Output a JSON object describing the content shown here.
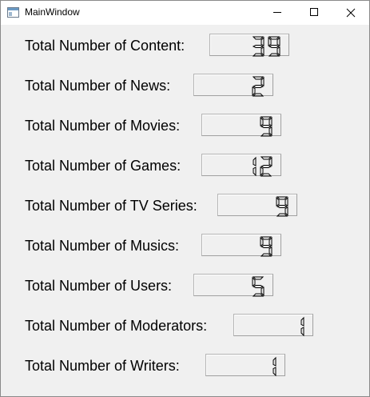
{
  "window": {
    "title": "MainWindow",
    "controls": {
      "minimize": "minimize-icon",
      "maximize": "maximize-icon",
      "close": "close-icon"
    }
  },
  "stats": [
    {
      "label": "Total Number of Content:",
      "value": "39"
    },
    {
      "label": "Total Number of News:",
      "value": "2"
    },
    {
      "label": "Total Number of Movies:",
      "value": "9"
    },
    {
      "label": "Total Number of Games:",
      "value": "12"
    },
    {
      "label": "Total Number of TV Series:",
      "value": "9"
    },
    {
      "label": "Total Number of Musics:",
      "value": "9"
    },
    {
      "label": "Total Number of Users:",
      "value": "5"
    },
    {
      "label": "Total Number of Moderators:",
      "value": "1"
    },
    {
      "label": "Total Number of Writers:",
      "value": "1"
    }
  ],
  "colors": {
    "window_bg": "#f0f0f0",
    "titlebar_bg": "#ffffff",
    "lcd_segment": "#000000"
  }
}
